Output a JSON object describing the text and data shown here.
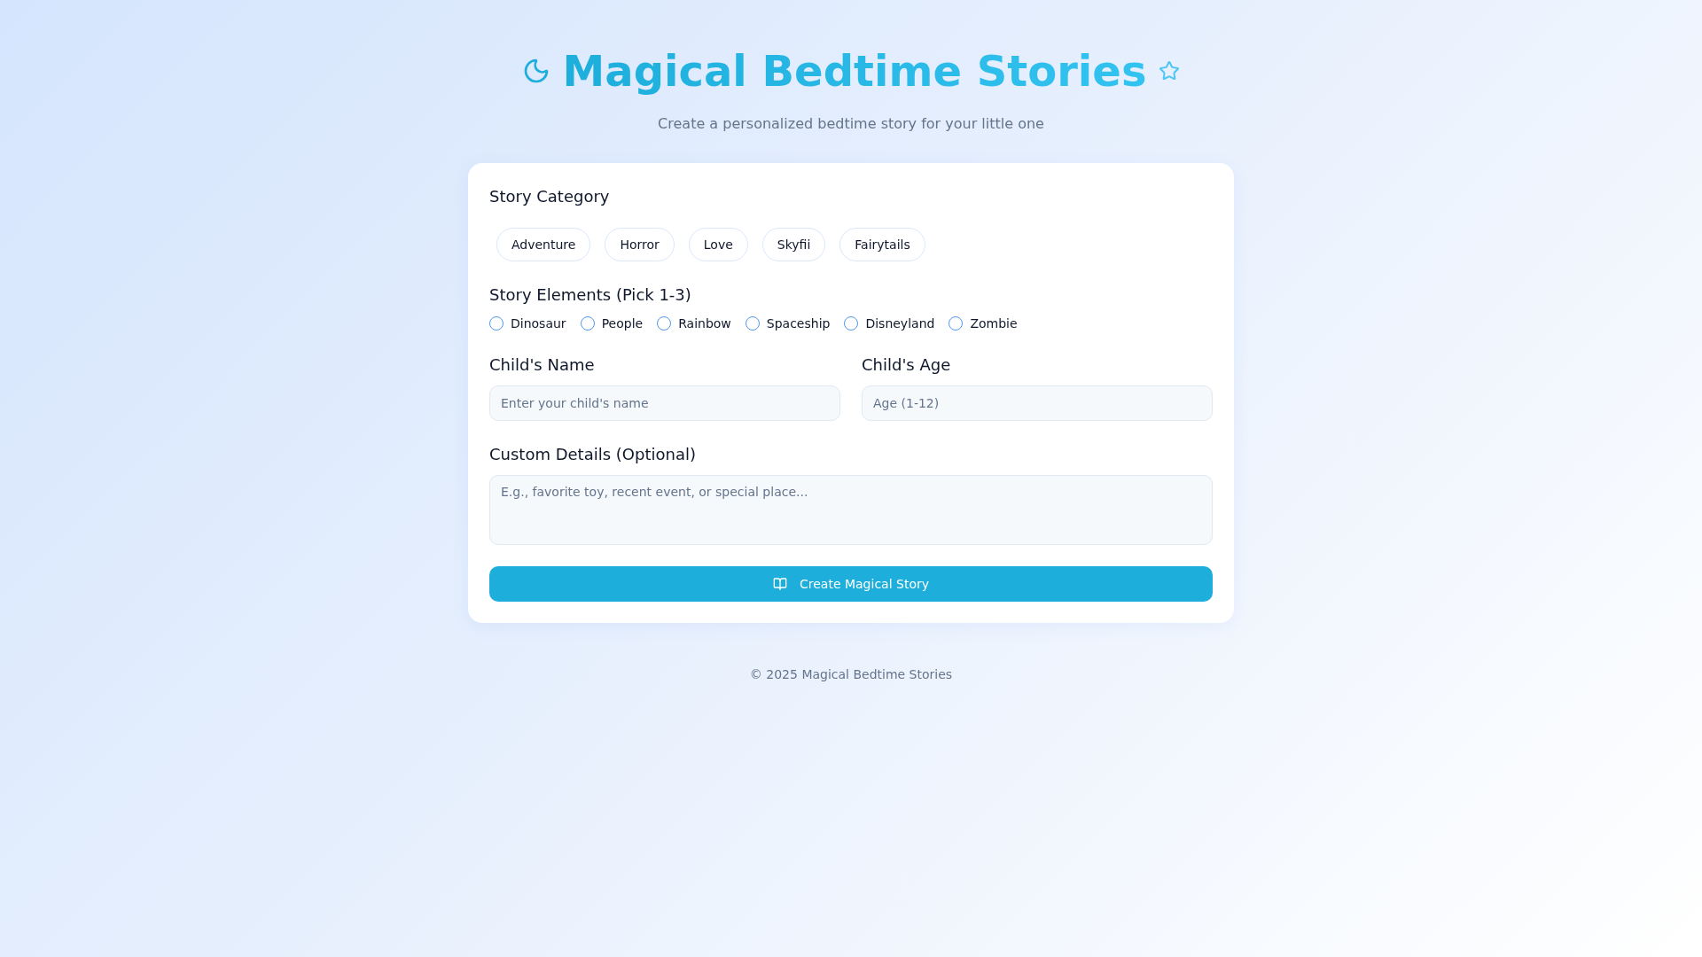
{
  "header": {
    "title": "Magical Bedtime Stories",
    "subtitle": "Create a personalized bedtime story for your little one"
  },
  "form": {
    "category": {
      "label": "Story Category",
      "options": [
        {
          "label": "Adventure",
          "selected": false
        },
        {
          "label": "Horror",
          "selected": false
        },
        {
          "label": "Love",
          "selected": false
        },
        {
          "label": "Skyfii",
          "selected": false
        },
        {
          "label": "Fairytails",
          "selected": false
        }
      ]
    },
    "elements": {
      "label": "Story Elements (Pick 1-3)",
      "options": [
        {
          "label": "Dinosaur",
          "checked": false
        },
        {
          "label": "People",
          "checked": false
        },
        {
          "label": "Rainbow",
          "checked": false
        },
        {
          "label": "Spaceship",
          "checked": false
        },
        {
          "label": "Disneyland",
          "checked": false
        },
        {
          "label": "Zombie",
          "checked": false
        }
      ]
    },
    "name_field": {
      "label": "Child's Name",
      "placeholder": "Enter your child's name"
    },
    "age_field": {
      "label": "Child's Age",
      "placeholder": "Age (1-12)"
    },
    "details_field": {
      "label": "Custom Details (Optional)",
      "placeholder": "E.g., favorite toy, recent event, or special place..."
    },
    "submit_button": {
      "label": "Create Magical Story"
    }
  },
  "footer": {
    "text": "© 2025 Magical Bedtime Stories"
  }
}
